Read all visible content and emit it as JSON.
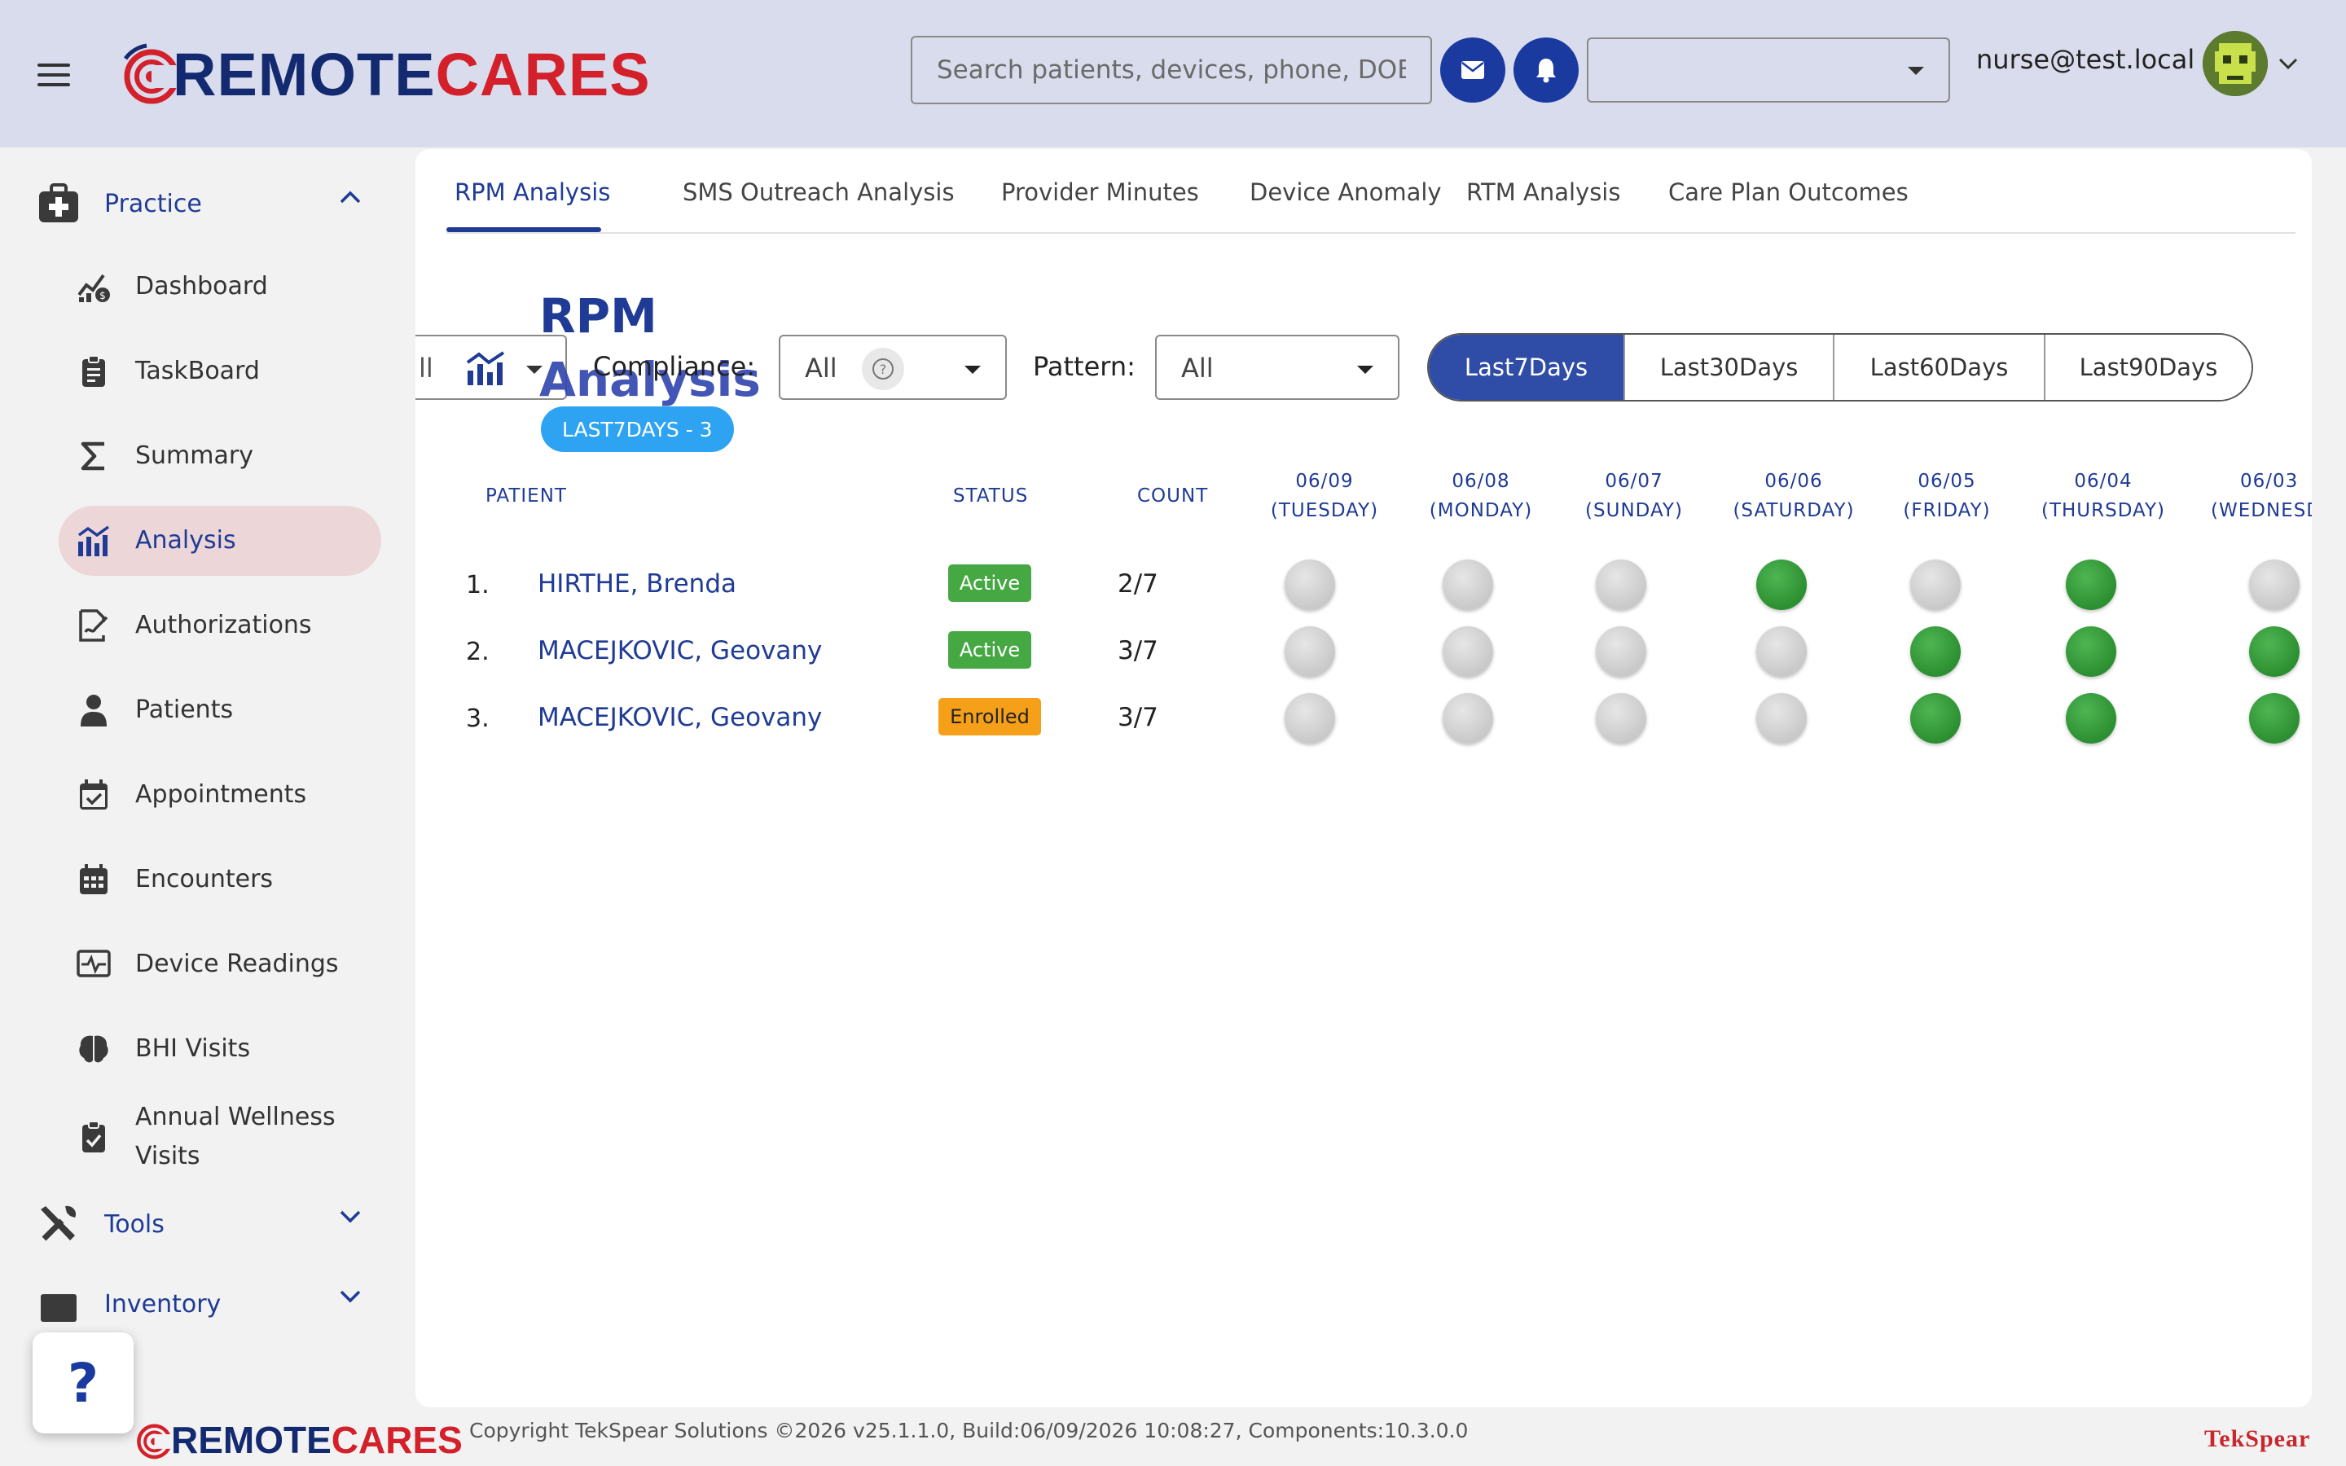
{
  "brand": {
    "name_part1": "REMOTE",
    "name_part2": "CARES",
    "primary_color": "#142a70",
    "accent_color": "#d3202a"
  },
  "header": {
    "menu_icon": "hamburger-icon",
    "search_placeholder": "Search patients, devices, phone, DOB",
    "mail_icon": "envelope-icon",
    "bell_icon": "bell-icon",
    "context_select_value": "",
    "user_email": "nurse@test.local",
    "avatar_icon": "avatar-icon"
  },
  "sidebar": {
    "practice_label": "Practice",
    "items": [
      {
        "label": "Dashboard",
        "icon": "dashboard-chart-icon"
      },
      {
        "label": "TaskBoard",
        "icon": "clipboard-icon"
      },
      {
        "label": "Summary",
        "icon": "sigma-icon"
      },
      {
        "label": "Analysis",
        "icon": "analysis-chart-icon",
        "active": true
      },
      {
        "label": "Authorizations",
        "icon": "signature-icon"
      },
      {
        "label": "Patients",
        "icon": "person-icon"
      },
      {
        "label": "Appointments",
        "icon": "calendar-check-icon"
      },
      {
        "label": "Encounters",
        "icon": "calendar-grid-icon"
      },
      {
        "label": "Device Readings",
        "icon": "monitor-pulse-icon"
      },
      {
        "label": "BHI Visits",
        "icon": "brain-icon"
      },
      {
        "label": "Annual Wellness Visits",
        "icon": "clipboard-check-icon"
      }
    ],
    "tools_label": "Tools",
    "inventory_label": "Inventory",
    "help_label": "?"
  },
  "tabs": [
    {
      "label": "RPM Analysis",
      "active": true
    },
    {
      "label": "SMS Outreach Analysis"
    },
    {
      "label": "Provider Minutes"
    },
    {
      "label": "Device Anomaly"
    },
    {
      "label": "RTM Analysis"
    },
    {
      "label": "Care Plan Outcomes"
    }
  ],
  "page": {
    "title_line1": "RPM",
    "title_line2": "Analysis",
    "badge": "LAST7DAYS - 3",
    "left_filter_partial": "ll",
    "compliance_label": "Compliance:",
    "compliance_value": "All",
    "pattern_label": "Pattern:",
    "pattern_value": "All",
    "ranges": [
      {
        "label": "Last7Days",
        "active": true
      },
      {
        "label": "Last30Days"
      },
      {
        "label": "Last60Days"
      },
      {
        "label": "Last90Days"
      }
    ]
  },
  "table": {
    "headers": {
      "patient": "PATIENT",
      "status": "STATUS",
      "count": "COUNT"
    },
    "days": [
      {
        "date": "06/09",
        "day": "(TUESDAY)"
      },
      {
        "date": "06/08",
        "day": "(MONDAY)"
      },
      {
        "date": "06/07",
        "day": "(SUNDAY)"
      },
      {
        "date": "06/06",
        "day": "(SATURDAY)"
      },
      {
        "date": "06/05",
        "day": "(FRIDAY)"
      },
      {
        "date": "06/04",
        "day": "(THURSDAY)"
      },
      {
        "date": "06/03",
        "day": "(WEDNESD"
      }
    ],
    "rows": [
      {
        "num": "1.",
        "name": "HIRTHE, Brenda",
        "status": "Active",
        "status_type": "active",
        "count": "2/7",
        "readings": [
          0,
          0,
          0,
          1,
          0,
          1,
          0
        ]
      },
      {
        "num": "2.",
        "name": "MACEJKOVIC, Geovany",
        "status": "Active",
        "status_type": "active",
        "count": "3/7",
        "readings": [
          0,
          0,
          0,
          0,
          1,
          1,
          1
        ]
      },
      {
        "num": "3.",
        "name": "MACEJKOVIC, Geovany",
        "status": "Enrolled",
        "status_type": "enrolled",
        "count": "3/7",
        "readings": [
          0,
          0,
          0,
          0,
          1,
          1,
          1
        ]
      }
    ],
    "status_colors": {
      "active": "#46a843",
      "enrolled": "#f6a019",
      "reading_on": "#2c8f31",
      "reading_off": "#c9c9c9"
    }
  },
  "footer": {
    "copyright": "Copyright TekSpear Solutions ©2026   v25.1.1.0, Build:06/09/2026 10:08:27, Components:10.3.0.0",
    "vendor": "TekSpear"
  }
}
